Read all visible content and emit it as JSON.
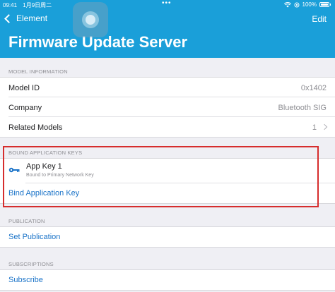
{
  "status_bar": {
    "time": "09:41",
    "date": "1月9日周二",
    "battery": "100%",
    "dots": "•••"
  },
  "nav": {
    "back_label": "Element",
    "edit_label": "Edit"
  },
  "title": "Firmware Update Server",
  "model_information": {
    "header": "MODEL INFORMATION",
    "rows": [
      {
        "label": "Model ID",
        "value": "0x1402"
      },
      {
        "label": "Company",
        "value": "Bluetooth SIG"
      },
      {
        "label": "Related Models",
        "value": "1"
      }
    ]
  },
  "bound_keys": {
    "header": "BOUND APPLICATION KEYS",
    "keys": [
      {
        "name": "App Key 1",
        "subtitle": "Bound to Primary Network Key"
      }
    ],
    "bind_label": "Bind Application Key"
  },
  "publication": {
    "header": "PUBLICATION",
    "action": "Set Publication"
  },
  "subscriptions": {
    "header": "SUBSCRIPTIONS",
    "action": "Subscribe"
  },
  "colors": {
    "accent": "#1a9fd9",
    "link": "#1a73c8",
    "highlight": "#d62d2d"
  },
  "icons": [
    "wifi-icon",
    "battery-icon",
    "back-chevron-icon",
    "key-icon",
    "chevron-right-icon",
    "assistive-touch-icon"
  ]
}
